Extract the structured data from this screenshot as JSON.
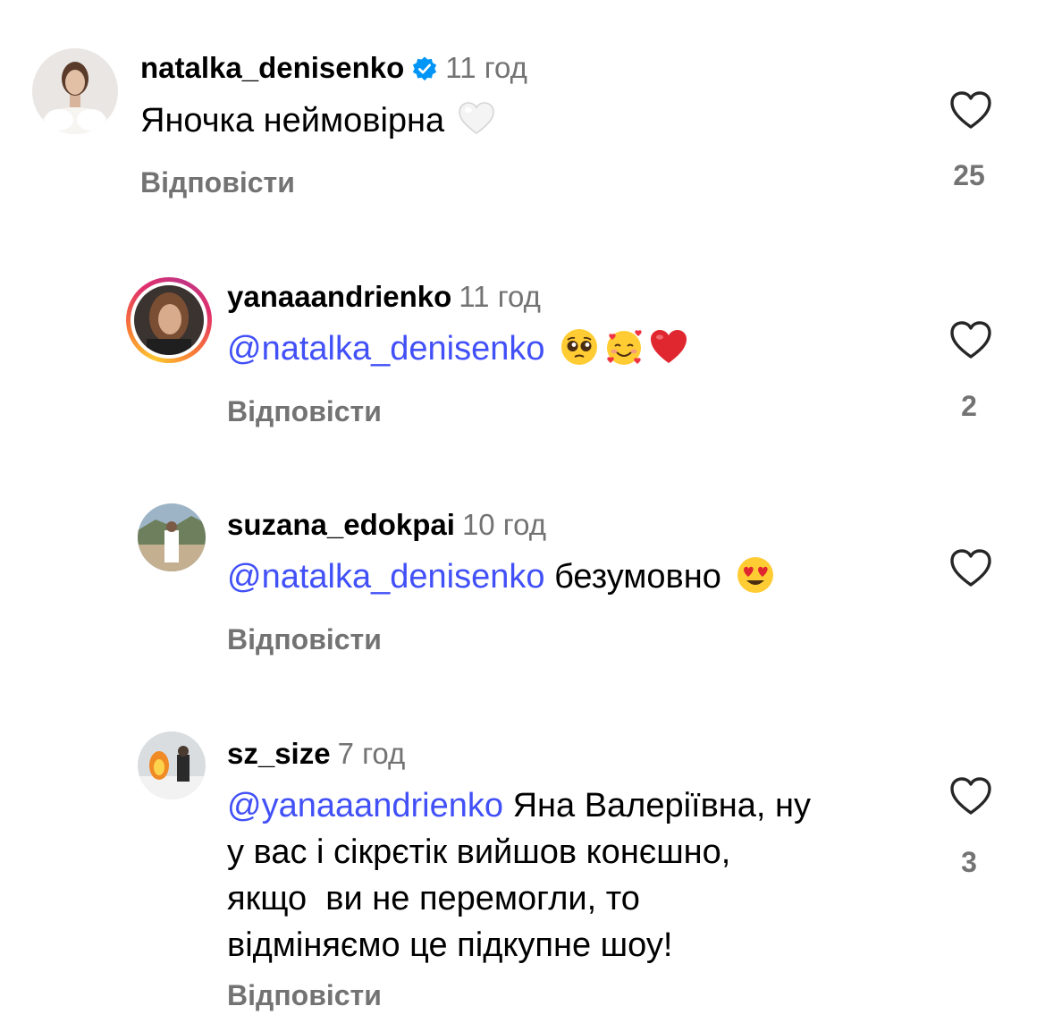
{
  "comments": [
    {
      "username": "natalka_denisenko",
      "verified": true,
      "time": "11 год",
      "text": "Яночка неймовірна",
      "emoji": [
        "white-heart"
      ],
      "reply_label": "Відповісти",
      "likes": "25"
    },
    {
      "username": "yanaaandrienko",
      "time": "11 год",
      "mention": "@natalka_denisenko",
      "emoji": [
        "pleading-face",
        "smiling-face-with-hearts",
        "red-heart"
      ],
      "reply_label": "Відповісти",
      "likes": "2"
    },
    {
      "username": "suzana_edokpai",
      "time": "10 год",
      "mention": "@natalka_denisenko",
      "text": "безумовно",
      "emoji": [
        "heart-eyes-face"
      ],
      "reply_label": "Відповісти",
      "likes": ""
    },
    {
      "username": "sz_size",
      "time": "7 год",
      "mention": "@yanaaandrienko",
      "text_lines": [
        "Яна Валеріївна, ну",
        "у вас і сікрєтік вийшов конєшно,",
        "якщо  ви не перемогли, то",
        "відміняємо це підкупне шоу!"
      ],
      "reply_label": "Відповісти",
      "likes": "3"
    }
  ],
  "colors": {
    "mention": "#4150f7",
    "secondary_text": "#737373",
    "verified_badge": "#0095f6"
  }
}
